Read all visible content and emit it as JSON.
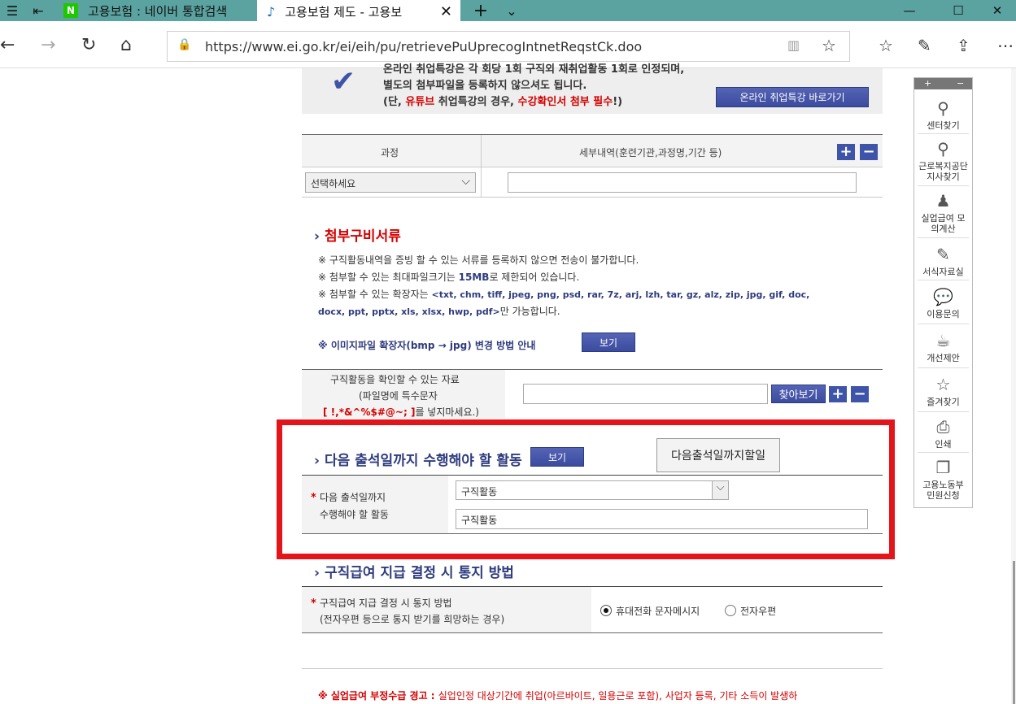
{
  "browser": {
    "tabs": [
      {
        "label": "고용보험 : 네이버 통합검색",
        "favicon": "N"
      },
      {
        "label": "고용보험 제도 - 고용보"
      }
    ],
    "url": "https://www.ei.go.kr/ei/eih/pu/retrievePuUprecogIntnetReqstCk.doo"
  },
  "top_notice": {
    "line1_cut": "온라인 취업특강은 각 회당 1회 구직외 재취업활동 1회로 인정되며,",
    "line2": "별도의 첨부파일을 등록하지 않으셔도 됩니다.",
    "line3_a": "(단, ",
    "line3_b": "유튜브",
    "line3_c": " 취업특강의 경우, ",
    "line3_d": "수강확인서 첨부 필수",
    "line3_e": "!)",
    "button": "온라인 취업특강 바로가기"
  },
  "course_table": {
    "col1": "과정",
    "col2": "세부내역(훈련기관,과정명,기간 등)",
    "select_value": "선택하세요",
    "plus": "+",
    "minus": "−"
  },
  "attachments": {
    "title": "첨부구비서류",
    "note1": "※ 구직활동내역을 증빙 할 수 있는 서류를 등록하지 않으면 전송이 불가합니다.",
    "note2_a": "※ 첨부할 수 있는 최대파일크기는 ",
    "note2_b": "15MB",
    "note2_c": "로 제한되어 있습니다.",
    "note3_a": "※ 첨부할 수 있는 확장자는 ",
    "note3_b": "<txt, chm, tiff, jpeg, png, psd, rar, 7z, arj, lzh, tar, gz, alz, zip, jpg, gif,      doc,",
    "note3_c": "docx, ppt, pptx, xls, xlsx, hwp, pdf>",
    "note3_d": "만 가능합니다.",
    "note4": "※ 이미지파일 확장자(bmp → jpg) 변경 방법 안내",
    "view_button": "보기",
    "file_label1": "구직활동을 확인할 수 있는 자료",
    "file_label2": "(파일명에 특수문자",
    "file_label3_a": "[ !,*&^%$#@~; ]",
    "file_label3_b": "를 넣지마세요.)",
    "browse_button": "찾아보기"
  },
  "next_activity": {
    "title": "다음 출석일까지 수행해야 할 활동",
    "view_button": "보기",
    "todo_button": "다음출석일까지할일",
    "label1": "다음 출석일까지",
    "label2": "수행해야 할 활동",
    "select_value": "구직활동",
    "input_value": "구직활동",
    "required": "*"
  },
  "notify": {
    "title": "구직급여 지급 결정 시 통지 방법",
    "label1": "구직급여 지급 결정 시 통지 방법",
    "label2": "(전자우편 등으로 통지 받기를 희망하는 경우)",
    "opt1": "휴대전화 문자메시지",
    "opt2": "전자우편",
    "required": "*"
  },
  "warning": {
    "bold": "※ 실업급여 부정수급 경고 : ",
    "text": "실업인정 대상기간에 취업(아르바이트, 일용근로 포함), 사업자 등록, 기타 소득이 발생하"
  },
  "quick_menu": {
    "items": [
      "센터찾기",
      "근로복지공단 지사찾기",
      "실업급여 모의계산",
      "서식자료실",
      "이용문의",
      "개선제안",
      "즐겨찾기",
      "인쇄",
      "고용노동부 민원신청"
    ]
  },
  "colors": {
    "tab_bar": "#5aa3a0",
    "accent_blue": "#3e54a8",
    "highlight_red": "#e4141b",
    "warning_red": "#d40000"
  }
}
